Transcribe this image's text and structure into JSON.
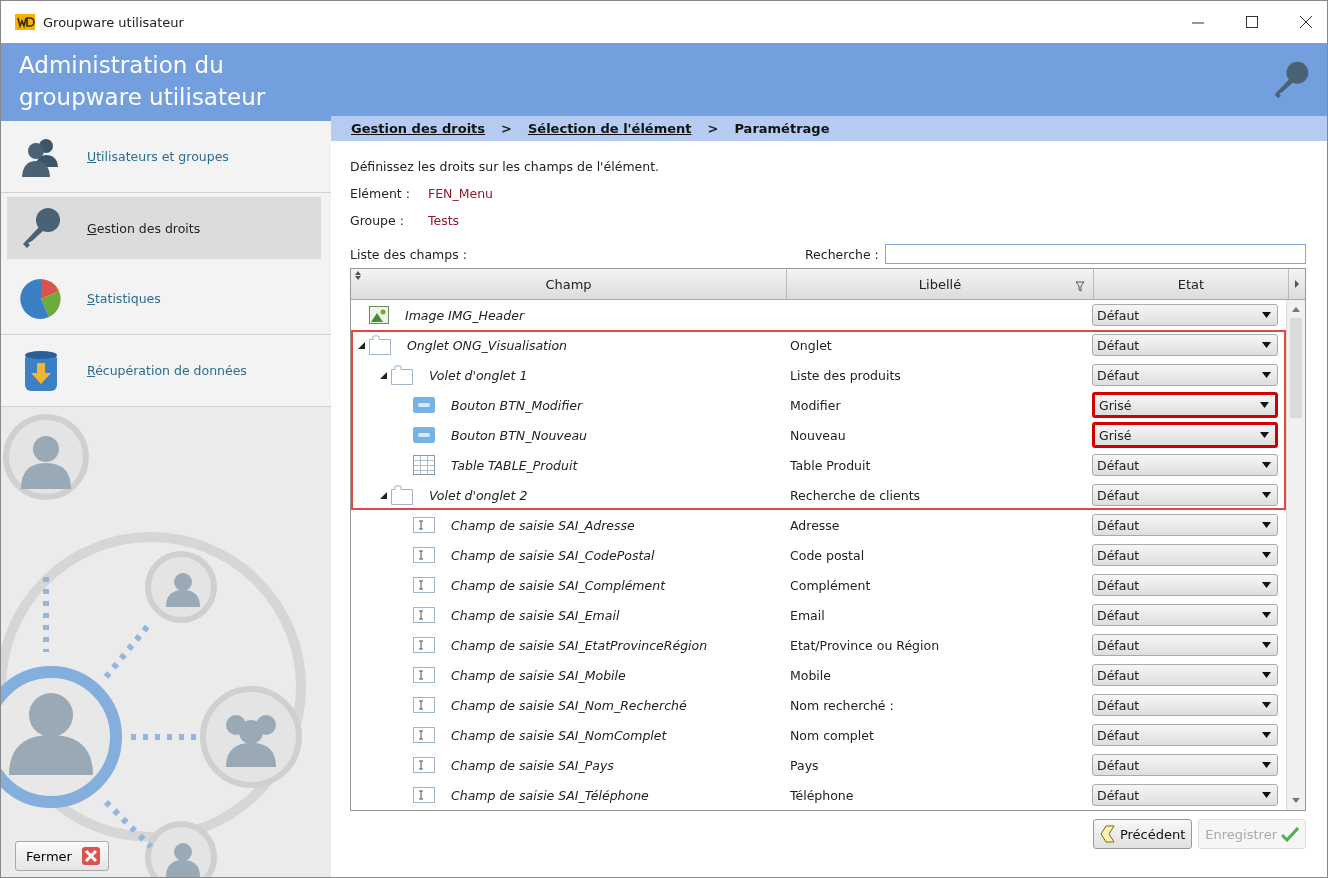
{
  "window": {
    "title": "Groupware utilisateur"
  },
  "sidebar": {
    "title": "Administration du groupware utilisateur",
    "items": [
      {
        "label": "Utilisateurs et groupes",
        "selected": false
      },
      {
        "label": "Gestion des droits",
        "selected": true
      },
      {
        "label": "Statistiques",
        "selected": false
      },
      {
        "label": "Récupération de données",
        "selected": false
      }
    ],
    "close_button": "Fermer"
  },
  "breadcrumb": [
    {
      "label": "Gestion des droits",
      "kind": "link"
    },
    {
      "separator": ">",
      "label": "Sélection de l'élément",
      "kind": "link"
    },
    {
      "separator": ">",
      "label": "Paramétrage",
      "kind": "current"
    }
  ],
  "instructions": "Définissez les droits sur les champs de l'élément.",
  "info": [
    {
      "label": "Elément :",
      "value": "FEN_Menu"
    },
    {
      "label": "Groupe :",
      "value": "Tests"
    }
  ],
  "list_label": "Liste des champs :",
  "search": {
    "label": "Recherche :"
  },
  "table": {
    "columns": [
      "Champ",
      "Libellé",
      "Etat"
    ],
    "rows": [
      {
        "kind": "image",
        "champ": "Image IMG_Header",
        "etat": "Défaut",
        "framed": false,
        "highlighted": false
      },
      {
        "kind": "tab",
        "champ": "Onglet ONG_Visualisation",
        "libelle": "Onglet",
        "etat": "Défaut",
        "framed": true,
        "highlighted": false,
        "expanded": true,
        "children": [
          {
            "kind": "pane",
            "champ": "Volet d'onglet 1",
            "libelle": "Liste des produits",
            "etat": "Défaut",
            "framed": true,
            "highlighted": false,
            "expanded": true,
            "children": [
              {
                "kind": "button",
                "champ": "Bouton BTN_Modifier",
                "libelle": "Modifier",
                "etat": "Grisé",
                "framed": true,
                "highlighted": true
              },
              {
                "kind": "button",
                "champ": "Bouton BTN_Nouveau",
                "libelle": "Nouveau",
                "etat": "Grisé",
                "framed": true,
                "highlighted": true
              },
              {
                "kind": "table",
                "champ": "Table TABLE_Produit",
                "libelle": "Table Produit",
                "etat": "Défaut",
                "framed": true,
                "highlighted": false
              }
            ]
          },
          {
            "kind": "pane",
            "champ": "Volet d'onglet 2",
            "libelle": "Recherche de clients",
            "etat": "Défaut",
            "framed": true,
            "highlighted": false,
            "expanded": true,
            "children": [
              {
                "kind": "input",
                "champ": "Champ de saisie SAI_Adresse",
                "libelle": "Adresse",
                "etat": "Défaut",
                "framed": false,
                "highlighted": false
              },
              {
                "kind": "input",
                "champ": "Champ de saisie SAI_CodePostal",
                "libelle": "Code postal",
                "etat": "Défaut",
                "framed": false,
                "highlighted": false
              },
              {
                "kind": "input",
                "champ": "Champ de saisie SAI_Complément",
                "libelle": "Complément",
                "etat": "Défaut",
                "framed": false,
                "highlighted": false
              },
              {
                "kind": "input",
                "champ": "Champ de saisie SAI_Email",
                "libelle": "Email",
                "etat": "Défaut",
                "framed": false,
                "highlighted": false
              },
              {
                "kind": "input",
                "champ": "Champ de saisie SAI_EtatProvinceRégion",
                "libelle": "Etat/Province ou Région",
                "etat": "Défaut",
                "framed": false,
                "highlighted": false
              },
              {
                "kind": "input",
                "champ": "Champ de saisie SAI_Mobile",
                "libelle": "Mobile",
                "etat": "Défaut",
                "framed": false,
                "highlighted": false
              },
              {
                "kind": "input",
                "champ": "Champ de saisie SAI_Nom_Recherché",
                "libelle": "Nom recherché :",
                "etat": "Défaut",
                "framed": false,
                "highlighted": false
              },
              {
                "kind": "input",
                "champ": "Champ de saisie SAI_NomComplet",
                "libelle": "Nom complet",
                "etat": "Défaut",
                "framed": false,
                "highlighted": false
              },
              {
                "kind": "input",
                "champ": "Champ de saisie SAI_Pays",
                "libelle": "Pays",
                "etat": "Défaut",
                "framed": false,
                "highlighted": false
              },
              {
                "kind": "input",
                "champ": "Champ de saisie SAI_Téléphone",
                "libelle": "Téléphone",
                "etat": "Défaut",
                "framed": false,
                "highlighted": false
              }
            ]
          }
        ]
      }
    ]
  },
  "buttons": [
    {
      "kind": "back",
      "label": "Précédent",
      "disabled": false
    },
    {
      "kind": "save",
      "label": "Enregistrer",
      "disabled": true
    }
  ]
}
